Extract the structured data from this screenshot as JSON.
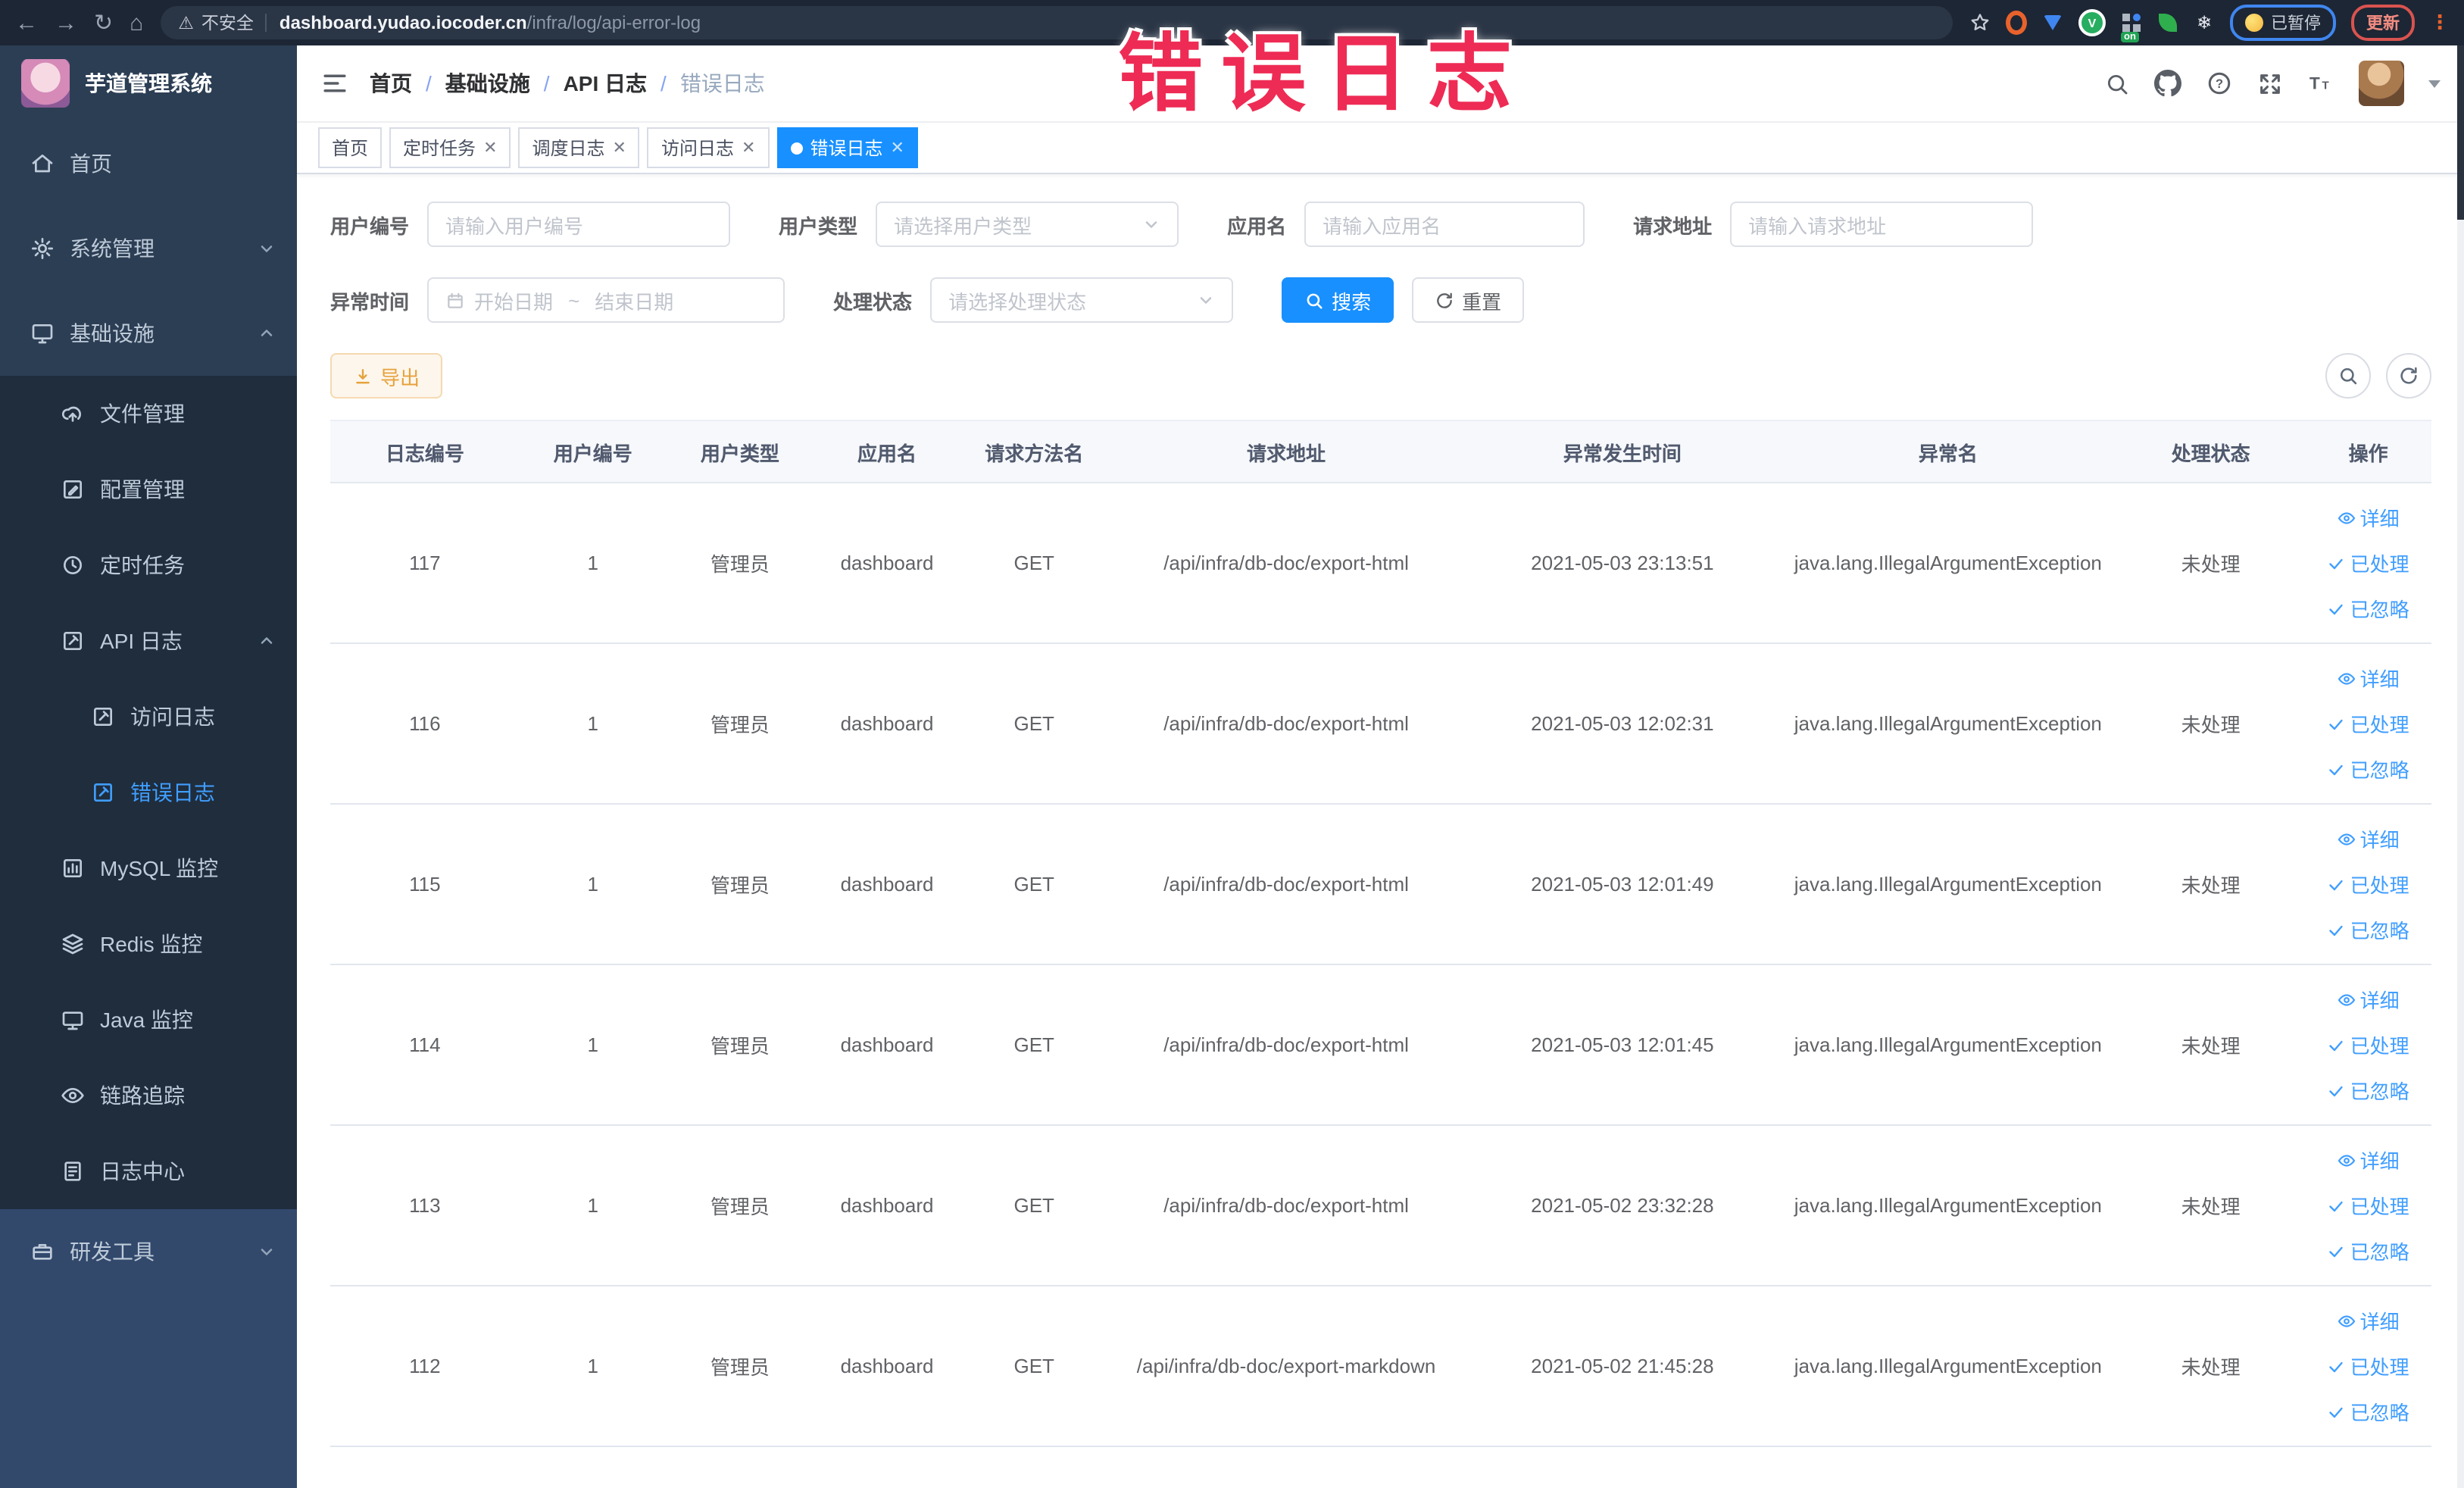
{
  "browser": {
    "security_label": "不安全",
    "url_host": "dashboard.yudao.iocoder.cn",
    "url_path": "/infra/log/api-error-log",
    "paused_label": "已暂停",
    "update_label": "更新"
  },
  "annotation": {
    "text": "错误日志",
    "color": "#ee2b54"
  },
  "sidebar": {
    "title": "芋道管理系统",
    "items": [
      {
        "label": "首页",
        "icon": "home-icon",
        "level": 1
      },
      {
        "label": "系统管理",
        "icon": "gear-icon",
        "level": 1,
        "chevron": "down"
      },
      {
        "label": "基础设施",
        "icon": "monitor-icon",
        "level": 1,
        "chevron": "up"
      },
      {
        "label": "文件管理",
        "icon": "upload-cloud-icon",
        "level": 2
      },
      {
        "label": "配置管理",
        "icon": "edit-icon",
        "level": 2
      },
      {
        "label": "定时任务",
        "icon": "clock-icon",
        "level": 2
      },
      {
        "label": "API 日志",
        "icon": "edit-square-icon",
        "level": 2,
        "chevron": "up"
      },
      {
        "label": "访问日志",
        "icon": "edit-square-icon",
        "level": 3
      },
      {
        "label": "错误日志",
        "icon": "edit-square-icon",
        "level": 3,
        "active": true
      },
      {
        "label": "MySQL 监控",
        "icon": "chart-icon",
        "level": 2
      },
      {
        "label": "Redis 监控",
        "icon": "layers-icon",
        "level": 2
      },
      {
        "label": "Java 监控",
        "icon": "display-icon",
        "level": 2
      },
      {
        "label": "链路追踪",
        "icon": "eye-icon",
        "level": 2
      },
      {
        "label": "日志中心",
        "icon": "log-file-icon",
        "level": 2
      },
      {
        "label": "研发工具",
        "icon": "toolbox-icon",
        "level": 1,
        "chevron": "down"
      }
    ]
  },
  "breadcrumb": {
    "items": [
      "首页",
      "基础设施",
      "API 日志",
      "错误日志"
    ],
    "separator": "/"
  },
  "tags": [
    {
      "label": "首页",
      "active": false,
      "closable": false
    },
    {
      "label": "定时任务",
      "active": false,
      "closable": true
    },
    {
      "label": "调度日志",
      "active": false,
      "closable": true
    },
    {
      "label": "访问日志",
      "active": false,
      "closable": true
    },
    {
      "label": "错误日志",
      "active": true,
      "closable": true
    }
  ],
  "filters": {
    "user_id": {
      "label": "用户编号",
      "placeholder": "请输入用户编号"
    },
    "user_type": {
      "label": "用户类型",
      "placeholder": "请选择用户类型"
    },
    "app_name": {
      "label": "应用名",
      "placeholder": "请输入应用名"
    },
    "request_url": {
      "label": "请求地址",
      "placeholder": "请输入请求地址"
    },
    "exception_time": {
      "label": "异常时间",
      "start_placeholder": "开始日期",
      "separator": "~",
      "end_placeholder": "结束日期"
    },
    "process_status": {
      "label": "处理状态",
      "placeholder": "请选择处理状态"
    },
    "search_label": "搜索",
    "reset_label": "重置"
  },
  "toolbar": {
    "export_label": "导出"
  },
  "table": {
    "columns": [
      "日志编号",
      "用户编号",
      "用户类型",
      "应用名",
      "请求方法名",
      "请求地址",
      "异常发生时间",
      "异常名",
      "处理状态",
      "操作"
    ],
    "row_actions": {
      "detail": "详细",
      "processed": "已处理",
      "ignored": "已忽略"
    },
    "rows": [
      {
        "log_id": "117",
        "user_id": "1",
        "user_type": "管理员",
        "app_name": "dashboard",
        "method": "GET",
        "url": "/api/infra/db-doc/export-html",
        "time": "2021-05-03 23:13:51",
        "exception": "java.lang.IllegalArgumentException",
        "status": "未处理"
      },
      {
        "log_id": "116",
        "user_id": "1",
        "user_type": "管理员",
        "app_name": "dashboard",
        "method": "GET",
        "url": "/api/infra/db-doc/export-html",
        "time": "2021-05-03 12:02:31",
        "exception": "java.lang.IllegalArgumentException",
        "status": "未处理"
      },
      {
        "log_id": "115",
        "user_id": "1",
        "user_type": "管理员",
        "app_name": "dashboard",
        "method": "GET",
        "url": "/api/infra/db-doc/export-html",
        "time": "2021-05-03 12:01:49",
        "exception": "java.lang.IllegalArgumentException",
        "status": "未处理"
      },
      {
        "log_id": "114",
        "user_id": "1",
        "user_type": "管理员",
        "app_name": "dashboard",
        "method": "GET",
        "url": "/api/infra/db-doc/export-html",
        "time": "2021-05-03 12:01:45",
        "exception": "java.lang.IllegalArgumentException",
        "status": "未处理"
      },
      {
        "log_id": "113",
        "user_id": "1",
        "user_type": "管理员",
        "app_name": "dashboard",
        "method": "GET",
        "url": "/api/infra/db-doc/export-html",
        "time": "2021-05-02 23:32:28",
        "exception": "java.lang.IllegalArgumentException",
        "status": "未处理"
      },
      {
        "log_id": "112",
        "user_id": "1",
        "user_type": "管理员",
        "app_name": "dashboard",
        "method": "GET",
        "url": "/api/infra/db-doc/export-markdown",
        "time": "2021-05-02 21:45:28",
        "exception": "java.lang.IllegalArgumentException",
        "status": "未处理"
      }
    ]
  },
  "colors": {
    "primary": "#1890ff",
    "link": "#409eff",
    "warning": "#e6a23c",
    "sidebar_bg": "#2c3e54",
    "submenu_bg": "#1f2d3d",
    "annotation_red": "#ee2b54"
  }
}
